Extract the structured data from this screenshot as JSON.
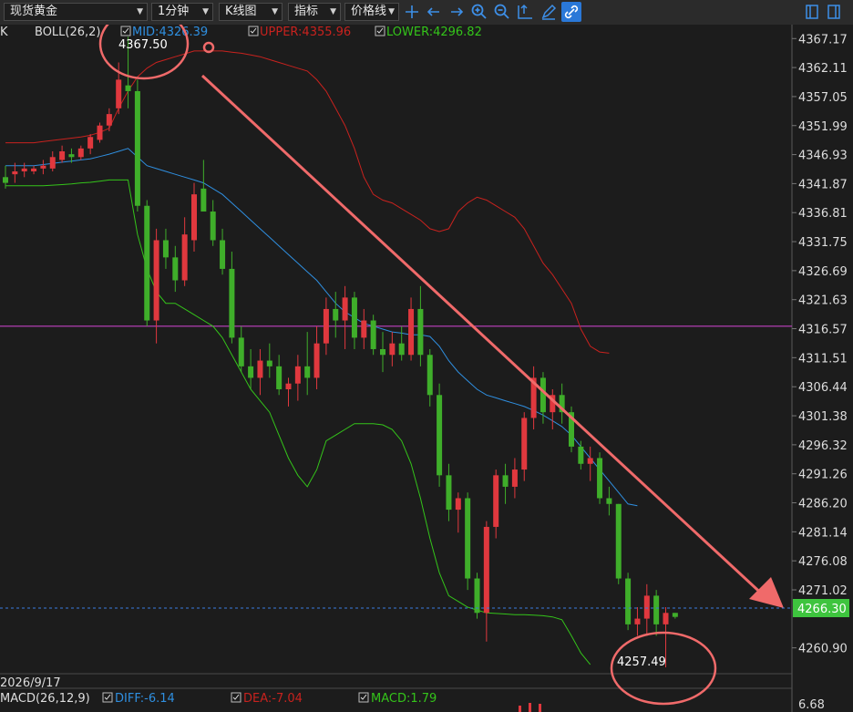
{
  "toolbar": {
    "symbol": "现货黄金",
    "period": "1分钟",
    "chart_kind": "K线图",
    "indicator": "指标",
    "price_line": "价格线"
  },
  "legend": {
    "k_prefix": "K",
    "boll_name": "BOLL(26,2)",
    "mid": "MID:4326.39",
    "upper": "UPPER:4355.96",
    "lower": "LOWER:4296.82"
  },
  "annotations": {
    "high_label": "4367.50",
    "low_label": "4257.49",
    "date_label": "2026/9/17",
    "current_price": "4266.30"
  },
  "macd": {
    "name": "MACD(26,12,9)",
    "diff": "DIFF:-6.14",
    "dea": "DEA:-7.04",
    "macd": "MACD:1.79",
    "axis_label": "6.68"
  },
  "colors": {
    "up": "#e0383e",
    "down": "#3fae2a",
    "upper": "#c8221e",
    "mid": "#2f8fe0",
    "lower": "#34c41a",
    "hline": "#c040c0",
    "annotation": "#f06a6a",
    "price_tag": "#3ec43e"
  },
  "chart_data": {
    "type": "candlestick",
    "ylim": [
      4258.3,
      4369.6
    ],
    "y_ticks": [
      4367.17,
      4362.11,
      4357.05,
      4351.99,
      4346.93,
      4341.87,
      4336.81,
      4331.75,
      4326.69,
      4321.63,
      4316.57,
      4311.51,
      4306.44,
      4301.38,
      4296.32,
      4291.26,
      4286.2,
      4281.14,
      4276.08,
      4271.02,
      4266.3,
      4260.9
    ],
    "horizontal_line": 4317.0,
    "current_price": 4266.3,
    "candles": [
      {
        "o": 4343.0,
        "h": 4345.0,
        "l": 4341.0,
        "c": 4342.0
      },
      {
        "o": 4343.5,
        "h": 4345.5,
        "l": 4342.0,
        "c": 4344.0
      },
      {
        "o": 4344.0,
        "h": 4345.5,
        "l": 4343.0,
        "c": 4344.5
      },
      {
        "o": 4344.0,
        "h": 4345.0,
        "l": 4343.5,
        "c": 4344.5
      },
      {
        "o": 4344.5,
        "h": 4346.0,
        "l": 4343.5,
        "c": 4345.0
      },
      {
        "o": 4344.5,
        "h": 4347.5,
        "l": 4344.0,
        "c": 4346.5
      },
      {
        "o": 4346.0,
        "h": 4348.5,
        "l": 4345.5,
        "c": 4347.5
      },
      {
        "o": 4347.0,
        "h": 4348.0,
        "l": 4345.5,
        "c": 4346.5
      },
      {
        "o": 4346.5,
        "h": 4348.5,
        "l": 4346.0,
        "c": 4348.0
      },
      {
        "o": 4348.0,
        "h": 4350.5,
        "l": 4347.0,
        "c": 4350.0
      },
      {
        "o": 4349.5,
        "h": 4352.5,
        "l": 4349.0,
        "c": 4352.0
      },
      {
        "o": 4352.0,
        "h": 4355.0,
        "l": 4351.0,
        "c": 4354.0
      },
      {
        "o": 4355.0,
        "h": 4363.0,
        "l": 4354.0,
        "c": 4360.0
      },
      {
        "o": 4359.0,
        "h": 4367.5,
        "l": 4355.0,
        "c": 4358.0
      },
      {
        "o": 4358.0,
        "h": 4360.0,
        "l": 4337.0,
        "c": 4338.0
      },
      {
        "o": 4338.0,
        "h": 4339.0,
        "l": 4317.0,
        "c": 4318.0
      },
      {
        "o": 4318.0,
        "h": 4334.0,
        "l": 4314.0,
        "c": 4332.0
      },
      {
        "o": 4332.0,
        "h": 4334.0,
        "l": 4327.0,
        "c": 4329.0
      },
      {
        "o": 4329.0,
        "h": 4331.0,
        "l": 4323.0,
        "c": 4325.0
      },
      {
        "o": 4325.0,
        "h": 4336.0,
        "l": 4324.0,
        "c": 4333.0
      },
      {
        "o": 4332.0,
        "h": 4342.0,
        "l": 4330.0,
        "c": 4340.0
      },
      {
        "o": 4341.0,
        "h": 4346.0,
        "l": 4338.0,
        "c": 4337.0
      },
      {
        "o": 4337.0,
        "h": 4339.0,
        "l": 4331.0,
        "c": 4332.0
      },
      {
        "o": 4332.0,
        "h": 4334.0,
        "l": 4326.0,
        "c": 4327.0
      },
      {
        "o": 4327.0,
        "h": 4330.0,
        "l": 4314.0,
        "c": 4315.0
      },
      {
        "o": 4315.0,
        "h": 4317.0,
        "l": 4309.0,
        "c": 4310.0
      },
      {
        "o": 4310.0,
        "h": 4313.0,
        "l": 4306.0,
        "c": 4308.0
      },
      {
        "o": 4308.0,
        "h": 4313.0,
        "l": 4305.0,
        "c": 4311.0
      },
      {
        "o": 4311.0,
        "h": 4314.0,
        "l": 4308.0,
        "c": 4310.0
      },
      {
        "o": 4310.0,
        "h": 4312.0,
        "l": 4305.0,
        "c": 4306.0
      },
      {
        "o": 4306.0,
        "h": 4308.0,
        "l": 4303.0,
        "c": 4307.0
      },
      {
        "o": 4307.0,
        "h": 4312.0,
        "l": 4304.0,
        "c": 4310.0
      },
      {
        "o": 4310.0,
        "h": 4316.0,
        "l": 4305.0,
        "c": 4308.0
      },
      {
        "o": 4308.0,
        "h": 4317.0,
        "l": 4306.0,
        "c": 4314.0
      },
      {
        "o": 4314.0,
        "h": 4322.0,
        "l": 4312.0,
        "c": 4320.0
      },
      {
        "o": 4320.0,
        "h": 4323.0,
        "l": 4315.0,
        "c": 4318.0
      },
      {
        "o": 4318.0,
        "h": 4324.0,
        "l": 4313.0,
        "c": 4322.0
      },
      {
        "o": 4322.0,
        "h": 4323.0,
        "l": 4313.0,
        "c": 4315.0
      },
      {
        "o": 4315.0,
        "h": 4320.0,
        "l": 4313.0,
        "c": 4318.0
      },
      {
        "o": 4318.0,
        "h": 4319.0,
        "l": 4312.0,
        "c": 4313.0
      },
      {
        "o": 4313.0,
        "h": 4316.0,
        "l": 4309.0,
        "c": 4312.0
      },
      {
        "o": 4312.0,
        "h": 4316.0,
        "l": 4310.0,
        "c": 4314.0
      },
      {
        "o": 4314.0,
        "h": 4317.0,
        "l": 4311.0,
        "c": 4312.0
      },
      {
        "o": 4312.0,
        "h": 4322.0,
        "l": 4311.0,
        "c": 4320.0
      },
      {
        "o": 4320.0,
        "h": 4324.0,
        "l": 4310.0,
        "c": 4312.0
      },
      {
        "o": 4312.0,
        "h": 4313.0,
        "l": 4303.0,
        "c": 4305.0
      },
      {
        "o": 4305.0,
        "h": 4307.0,
        "l": 4289.0,
        "c": 4291.0
      },
      {
        "o": 4291.0,
        "h": 4293.0,
        "l": 4283.0,
        "c": 4285.0
      },
      {
        "o": 4285.0,
        "h": 4288.0,
        "l": 4281.0,
        "c": 4287.0
      },
      {
        "o": 4287.0,
        "h": 4288.0,
        "l": 4271.0,
        "c": 4273.0
      },
      {
        "o": 4273.0,
        "h": 4274.0,
        "l": 4266.0,
        "c": 4267.0
      },
      {
        "o": 4267.0,
        "h": 4283.0,
        "l": 4262.0,
        "c": 4282.0
      },
      {
        "o": 4282.0,
        "h": 4292.0,
        "l": 4280.0,
        "c": 4291.0
      },
      {
        "o": 4291.0,
        "h": 4293.0,
        "l": 4286.0,
        "c": 4289.0
      },
      {
        "o": 4289.0,
        "h": 4294.0,
        "l": 4287.0,
        "c": 4292.0
      },
      {
        "o": 4292.0,
        "h": 4302.0,
        "l": 4290.0,
        "c": 4301.0
      },
      {
        "o": 4301.0,
        "h": 4310.0,
        "l": 4299.0,
        "c": 4308.0
      },
      {
        "o": 4308.0,
        "h": 4309.0,
        "l": 4300.0,
        "c": 4302.0
      },
      {
        "o": 4302.0,
        "h": 4306.0,
        "l": 4299.0,
        "c": 4305.0
      },
      {
        "o": 4305.0,
        "h": 4307.0,
        "l": 4300.0,
        "c": 4302.0
      },
      {
        "o": 4302.0,
        "h": 4303.0,
        "l": 4295.0,
        "c": 4296.0
      },
      {
        "o": 4296.0,
        "h": 4297.0,
        "l": 4292.0,
        "c": 4293.0
      },
      {
        "o": 4293.0,
        "h": 4296.0,
        "l": 4290.0,
        "c": 4294.0
      },
      {
        "o": 4294.0,
        "h": 4295.0,
        "l": 4286.0,
        "c": 4287.0
      },
      {
        "o": 4287.0,
        "h": 4289.0,
        "l": 4284.0,
        "c": 4286.0
      },
      {
        "o": 4286.0,
        "h": 4286.0,
        "l": 4272.0,
        "c": 4273.0
      },
      {
        "o": 4273.0,
        "h": 4274.0,
        "l": 4264.0,
        "c": 4265.0
      },
      {
        "o": 4265.0,
        "h": 4268.0,
        "l": 4263.0,
        "c": 4266.0
      },
      {
        "o": 4266.0,
        "h": 4272.0,
        "l": 4263.0,
        "c": 4270.0
      },
      {
        "o": 4270.0,
        "h": 4271.0,
        "l": 4263.0,
        "c": 4265.0
      },
      {
        "o": 4265.0,
        "h": 4268.0,
        "l": 4257.5,
        "c": 4267.0
      },
      {
        "o": 4267.0,
        "h": 4267.0,
        "l": 4266.0,
        "c": 4266.3
      }
    ],
    "upper_band": [
      4349,
      4349,
      4349,
      4349,
      4349.2,
      4349.4,
      4349.6,
      4349.8,
      4350,
      4350.3,
      4350.8,
      4351.5,
      4355,
      4358,
      4360.5,
      4362,
      4363,
      4363.5,
      4364,
      4364.5,
      4365,
      4365,
      4365,
      4365,
      4364.8,
      4364.6,
      4364.3,
      4364,
      4363.5,
      4363,
      4362.5,
      4362,
      4361.5,
      4360,
      4358,
      4355,
      4352,
      4348,
      4343,
      4340,
      4339,
      4338.5,
      4337.5,
      4336.5,
      4335.5,
      4334,
      4333.5,
      4334,
      4337,
      4338.5,
      4339.5,
      4339,
      4338,
      4337,
      4336,
      4334,
      4331,
      4328,
      4326,
      4323.5,
      4321,
      4316.5,
      4313.5,
      4312.5,
      4312.3
    ],
    "mid_band": [
      4345,
      4345,
      4345,
      4345,
      4345.2,
      4345.4,
      4345.6,
      4345.8,
      4346,
      4346.2,
      4346.6,
      4347,
      4347.5,
      4348,
      4346.5,
      4345,
      4344.5,
      4344,
      4343.5,
      4343,
      4342.5,
      4342,
      4341,
      4340,
      4338.5,
      4337,
      4335.5,
      4334,
      4332.5,
      4331,
      4329.5,
      4328,
      4326.5,
      4325,
      4323,
      4321,
      4319.5,
      4318.5,
      4317.5,
      4317,
      4316.5,
      4316,
      4315.8,
      4315.5,
      4315.5,
      4315.2,
      4313.5,
      4311,
      4309,
      4307.5,
      4306,
      4305,
      4304.5,
      4304,
      4303.5,
      4303,
      4302.3,
      4301.5,
      4300.5,
      4299.5,
      4298,
      4296,
      4294,
      4292,
      4290,
      4288,
      4286,
      4285.7
    ],
    "lower_band": [
      4341.5,
      4341.5,
      4341.5,
      4341.5,
      4341.5,
      4341.6,
      4341.7,
      4341.8,
      4342,
      4342.1,
      4342.3,
      4342.5,
      4342.5,
      4342.5,
      4333,
      4327,
      4323,
      4321,
      4321,
      4320,
      4319,
      4318,
      4317,
      4315,
      4312,
      4309,
      4306,
      4304,
      4302,
      4298,
      4294,
      4291,
      4289,
      4292,
      4297,
      4298,
      4299,
      4300,
      4300,
      4300,
      4299.8,
      4299,
      4297,
      4293,
      4287,
      4280,
      4274,
      4270,
      4269,
      4268,
      4267.5,
      4267,
      4266.9,
      4266.8,
      4266.7,
      4266.7,
      4266.6,
      4266.5,
      4266.3,
      4265.8,
      4263,
      4260,
      4258
    ]
  }
}
